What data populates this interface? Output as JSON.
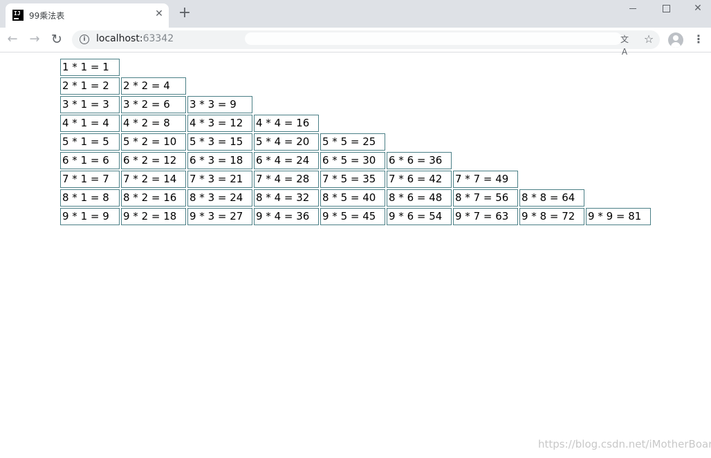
{
  "browser": {
    "tab_title": "99乘法表",
    "tab_favicon_text": "IJ",
    "tab_close_glyph": "✕",
    "new_tab_glyph": "+",
    "url_host": "localhost:",
    "url_port": "63342",
    "translate_glyph": "文A",
    "star_glyph": "☆",
    "menu_glyph": "⋮",
    "back_glyph": "←",
    "forward_glyph": "→",
    "reload_glyph": "↻",
    "info_glyph": "i"
  },
  "table": {
    "rows": [
      [
        "1 * 1 = 1"
      ],
      [
        "2 * 1 = 2",
        "2 * 2 = 4"
      ],
      [
        "3 * 1 = 3",
        "3 * 2 = 6",
        "3 * 3 = 9"
      ],
      [
        "4 * 1 = 4",
        "4 * 2 = 8",
        "4 * 3 = 12",
        "4 * 4 = 16"
      ],
      [
        "5 * 1 = 5",
        "5 * 2 = 10",
        "5 * 3 = 15",
        "5 * 4 = 20",
        "5 * 5 = 25"
      ],
      [
        "6 * 1 = 6",
        "6 * 2 = 12",
        "6 * 3 = 18",
        "6 * 4 = 24",
        "6 * 5 = 30",
        "6 * 6 = 36"
      ],
      [
        "7 * 1 = 7",
        "7 * 2 = 14",
        "7 * 3 = 21",
        "7 * 4 = 28",
        "7 * 5 = 35",
        "7 * 6 = 42",
        "7 * 7 = 49"
      ],
      [
        "8 * 1 = 8",
        "8 * 2 = 16",
        "8 * 3 = 24",
        "8 * 4 = 32",
        "8 * 5 = 40",
        "8 * 6 = 48",
        "8 * 7 = 56",
        "8 * 8 = 64"
      ],
      [
        "9 * 1 = 9",
        "9 * 2 = 18",
        "9 * 3 = 27",
        "9 * 4 = 36",
        "9 * 5 = 45",
        "9 * 6 = 54",
        "9 * 7 = 63",
        "9 * 8 = 72",
        "9 * 9 = 81"
      ]
    ]
  },
  "watermark": "https://blog.csdn.net/iMotherBoard",
  "colors": {
    "cell_border": "#4a7f86",
    "tabstrip_bg": "#dee1e6",
    "omnibox_bg": "#f1f3f4"
  }
}
